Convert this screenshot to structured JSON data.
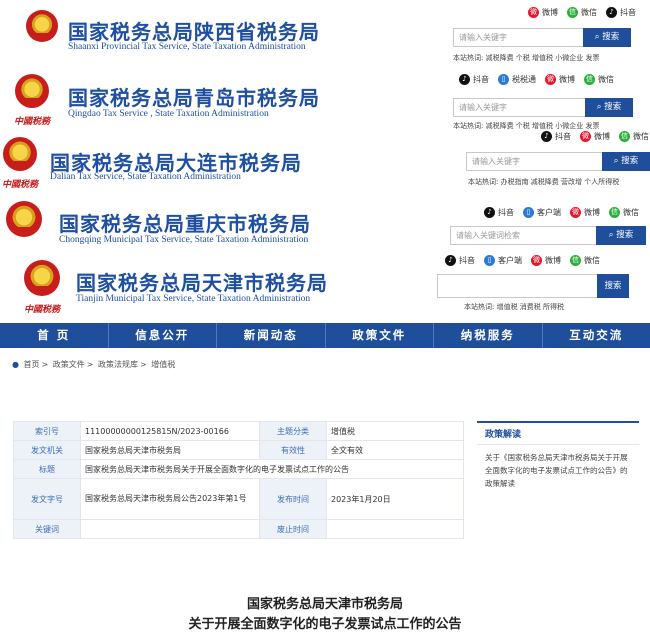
{
  "headers": [
    {
      "title": "国家税务总局陕西省税务局",
      "subtitle": "Shaanxi Provincial Tax Service, State Taxation Administration",
      "social": [
        "微博",
        "微信",
        "抖音"
      ],
      "search_placeholder": "请输入关键字",
      "search_button": "搜索",
      "hot": "本站热词: 减税降费 个税 增值税 小微企业 发票",
      "seal": ""
    },
    {
      "title": "国家税务总局青岛市税务局",
      "subtitle": "Qingdao Tax Service , State Taxation Administration",
      "social": [
        "抖音",
        "税税通",
        "微博",
        "微信"
      ],
      "search_placeholder": "请输入关键字",
      "search_button": "搜索",
      "hot": "本站热词: 减税降费 个税 增值税 小微企业 发票",
      "seal": "中國税務"
    },
    {
      "title": "国家税务总局大连市税务局",
      "subtitle": "Dalian Tax Service, State Taxation Administration",
      "social": [
        "抖音",
        "微博",
        "微信"
      ],
      "search_placeholder": "请输入关键字",
      "search_button": "搜索",
      "hot": "本站热词: 办税指南 减税降费 营改增 个人所得税",
      "seal": "中國税務"
    },
    {
      "title": "国家税务总局重庆市税务局",
      "subtitle": "Chongqing Municipal Tax Service, State Taxation Administration",
      "social": [
        "抖音",
        "客户端",
        "微博",
        "微信"
      ],
      "search_placeholder": "请输入关键词检索",
      "search_button": "搜索",
      "hot": "",
      "seal": ""
    },
    {
      "title": "国家税务总局天津市税务局",
      "subtitle": "Tianjin Municipal Tax Service, State Taxation Administration",
      "social": [
        "抖音",
        "客户端",
        "微博",
        "微信"
      ],
      "search_placeholder": "",
      "search_button": "搜索",
      "hot": "本站热词: 增值税 消费税 所得税",
      "seal": "中國税務"
    }
  ],
  "nav": [
    "首 页",
    "信息公开",
    "新闻动态",
    "政策文件",
    "纳税服务",
    "互动交流"
  ],
  "breadcrumb": [
    "首页",
    "政策文件",
    "政策法规库",
    "增值税"
  ],
  "meta": {
    "index_label": "索引号",
    "index_value": "11100000000125815N/2023-00166",
    "topic_label": "主题分类",
    "topic_value": "增值税",
    "issuer_label": "发文机关",
    "issuer_value": "国家税务总局天津市税务局",
    "validity_label": "有效性",
    "validity_value": "全文有效",
    "title_label": "标题",
    "title_value": "国家税务总局天津市税务局关于开展全面数字化的电子发票试点工作的公告",
    "docno_label": "发文字号",
    "docno_value": "国家税务总局天津市税务局公告2023年第1号",
    "date_label": "发布时间",
    "date_value": "2023年1月20日",
    "keyword_label": "关键词",
    "keyword_value": "",
    "abolish_label": "废止时间",
    "abolish_value": ""
  },
  "sidebar": {
    "heading": "政策解读",
    "text": "关于《国家税务总局天津市税务局关于开展全面数字化的电子发票试点工作的公告》的政策解读"
  },
  "document": {
    "line1": "国家税务总局天津市税务局",
    "line2": "关于开展全面数字化的电子发票试点工作的公告"
  }
}
